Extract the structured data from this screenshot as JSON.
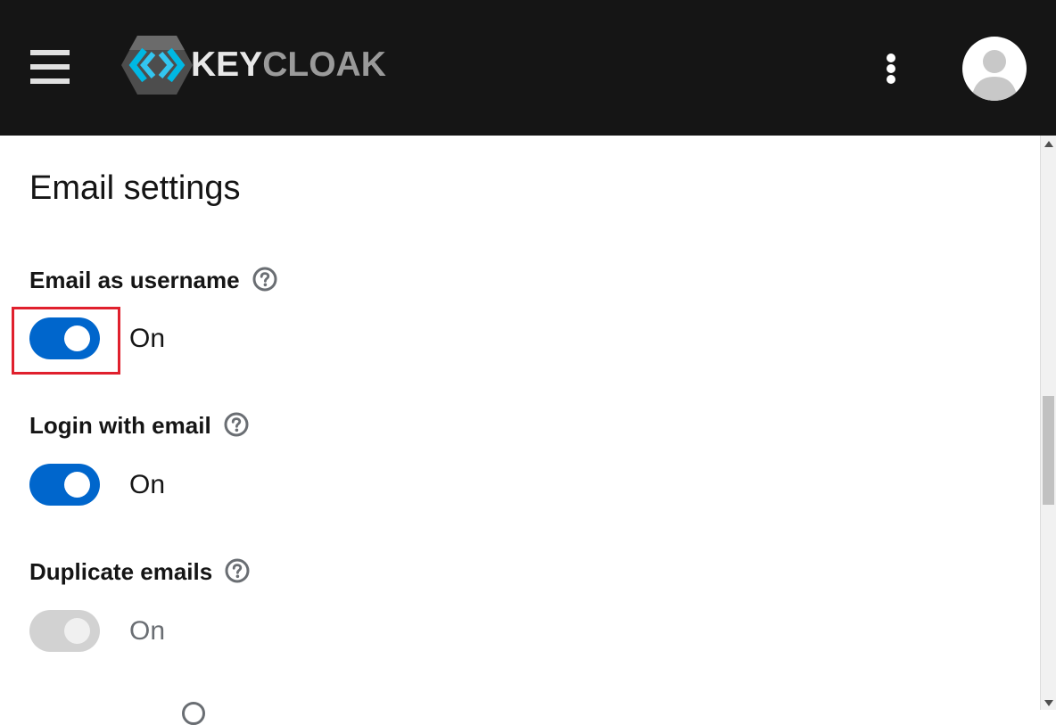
{
  "header": {
    "brand": {
      "key": "KEY",
      "cloak": "CLOAK"
    }
  },
  "page": {
    "title": "Email settings"
  },
  "settings": [
    {
      "label": "Email as username",
      "state": "On",
      "enabled": true
    },
    {
      "label": "Login with email",
      "state": "On",
      "enabled": true
    },
    {
      "label": "Duplicate emails",
      "state": "On",
      "enabled": false
    }
  ],
  "colors": {
    "masthead": "#151515",
    "switch_on": "#0066cc",
    "switch_disabled": "#d2d2d2",
    "highlight": "#e0202d"
  },
  "icons": {
    "menu": "hamburger-icon",
    "more": "kebab-icon",
    "user": "avatar-icon",
    "help": "question-circle-icon"
  }
}
